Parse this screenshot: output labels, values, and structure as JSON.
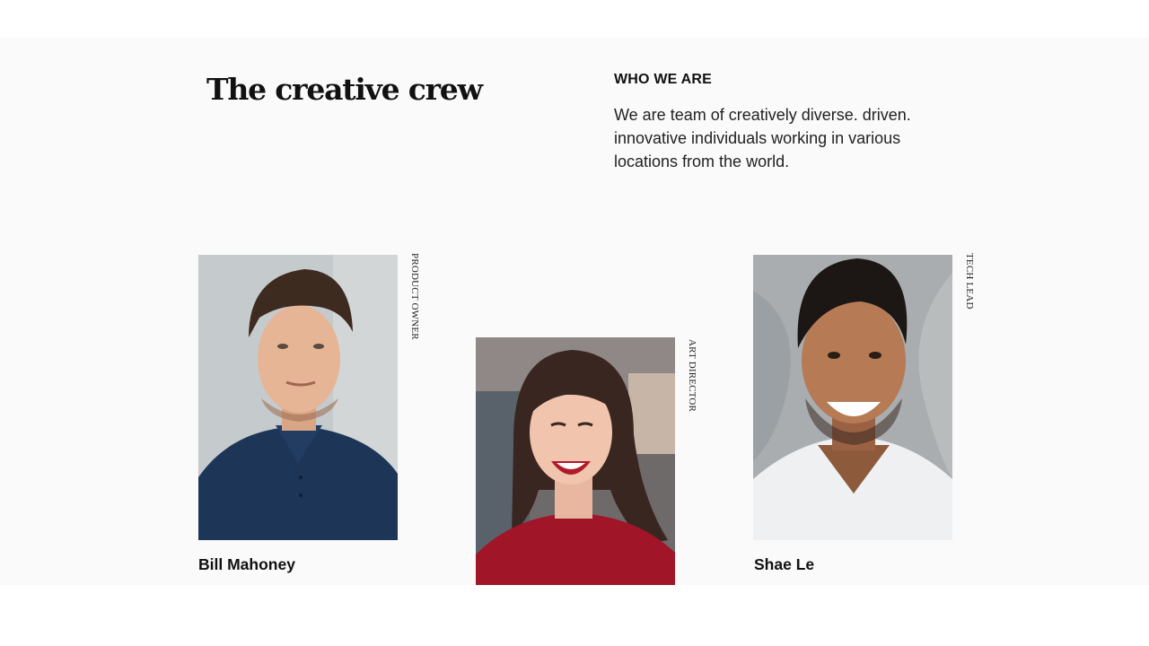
{
  "section": {
    "title": "The creative crew",
    "eyebrow": "WHO WE ARE",
    "intro": "We are team of creatively diverse. driven. innovative individuals working in various locations from the world."
  },
  "team": [
    {
      "name": "Bill Mahoney",
      "role": "PRODUCT OWNER"
    },
    {
      "name": "",
      "role": "ART DIRECTOR"
    },
    {
      "name": "Shae Le",
      "role": "TECH LEAD"
    }
  ],
  "colors": {
    "section_bg": "#fafafa",
    "text": "#111111"
  }
}
